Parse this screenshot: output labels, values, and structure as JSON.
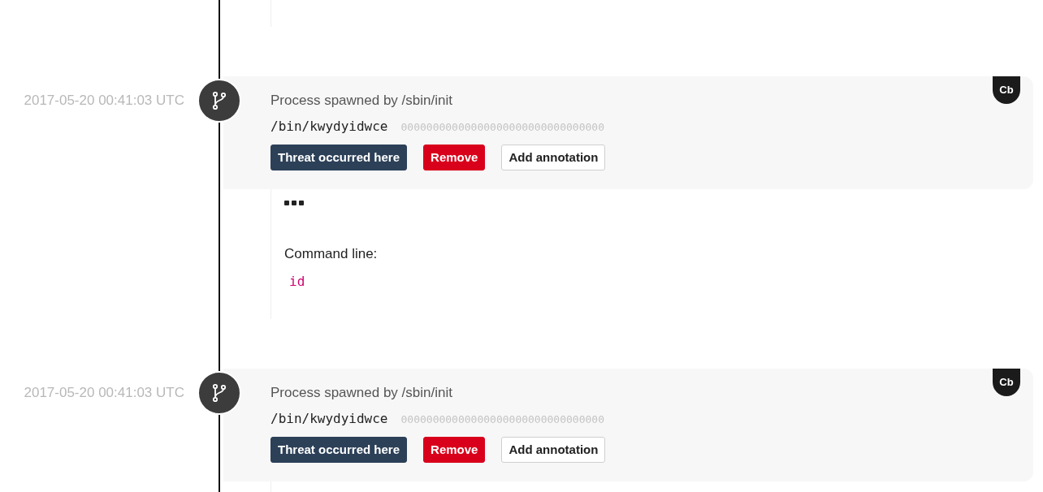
{
  "events": [
    {
      "timestamp": "2017-05-20 00:41:03 UTC",
      "title": "Process spawned by /sbin/init",
      "path": "/bin/kwydyidwce",
      "hash": "00000000000000000000000000000000",
      "badge": "Cb",
      "buttons": [
        {
          "label": "Threat occurred here",
          "kind": "primary"
        },
        {
          "label": "Remove",
          "kind": "danger"
        },
        {
          "label": "Add annotation",
          "kind": "default"
        }
      ],
      "details": {
        "label": "Command line:",
        "command": "id"
      }
    },
    {
      "timestamp": "2017-05-20 00:41:03 UTC",
      "title": "Process spawned by /sbin/init",
      "path": "/bin/kwydyidwce",
      "hash": "00000000000000000000000000000000",
      "badge": "Cb",
      "buttons": [
        {
          "label": "Threat occurred here",
          "kind": "primary"
        },
        {
          "label": "Remove",
          "kind": "danger"
        },
        {
          "label": "Add annotation",
          "kind": "default"
        }
      ]
    }
  ]
}
